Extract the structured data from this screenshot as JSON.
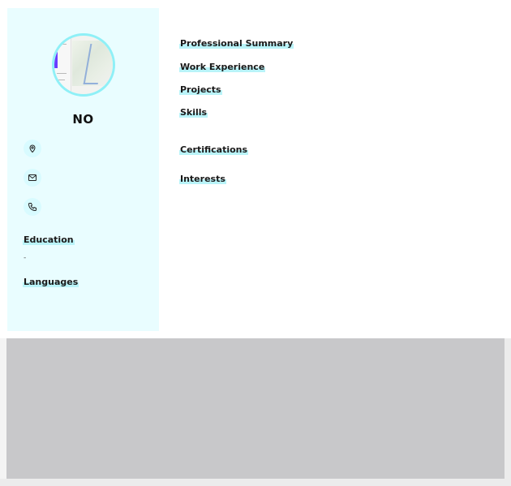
{
  "profile": {
    "name": "NO"
  },
  "sidebar": {
    "education_title": "Education",
    "education_placeholder": "-",
    "languages_title": "Languages"
  },
  "main": {
    "sections": [
      "Professional Summary",
      "Work Experience",
      "Projects",
      "Skills",
      "Certifications",
      "Interests"
    ]
  },
  "icons": {
    "location": "location-pin-icon",
    "email": "mail-icon",
    "phone": "phone-icon"
  },
  "colors": {
    "sidebar_bg": "#e9fdff",
    "accent": "#8ff0f7",
    "highlight": "#b9f3f8",
    "overlay_gray": "#c8c8ca"
  }
}
